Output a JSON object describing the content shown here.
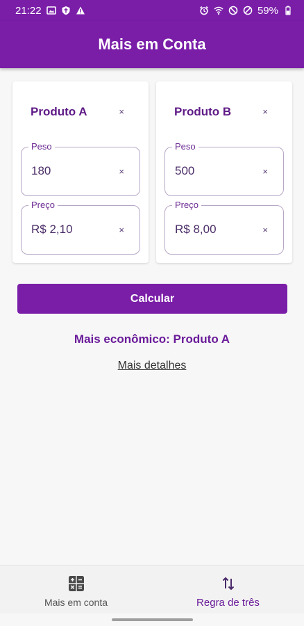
{
  "status_bar": {
    "time": "21:22",
    "battery": "59%",
    "left_icons": [
      "image-icon",
      "shield-icon",
      "warning-icon"
    ],
    "right_icons": [
      "alarm-icon",
      "wifi-icon",
      "do-not-disturb-icon",
      "blocked-icon",
      "battery-icon"
    ]
  },
  "app_bar": {
    "title": "Mais em Conta"
  },
  "products": [
    {
      "title": "Produto A",
      "clear": "×",
      "peso_label": "Peso",
      "peso_value": "180",
      "peso_clear": "×",
      "preco_label": "Preço",
      "preco_value": "R$ 2,10",
      "preco_clear": "×"
    },
    {
      "title": "Produto B",
      "clear": "×",
      "peso_label": "Peso",
      "peso_value": "500",
      "peso_clear": "×",
      "preco_label": "Preço",
      "preco_value": "R$ 8,00",
      "preco_clear": "×"
    }
  ],
  "calculate_button": "Calcular",
  "result_text": "Mais econômico: Produto A",
  "details_link": "Mais detalhes",
  "bottom_nav": {
    "items": [
      {
        "label": "Mais em conta",
        "icon": "calculator-icon"
      },
      {
        "label": "Regra de três",
        "icon": "swap-vertical-icon"
      }
    ],
    "active_index": 1
  },
  "colors": {
    "primary": "#7a1ea8",
    "primary_text": "#6a1b9a",
    "field_border": "#b7a6c6",
    "background": "#f7f7f7"
  }
}
